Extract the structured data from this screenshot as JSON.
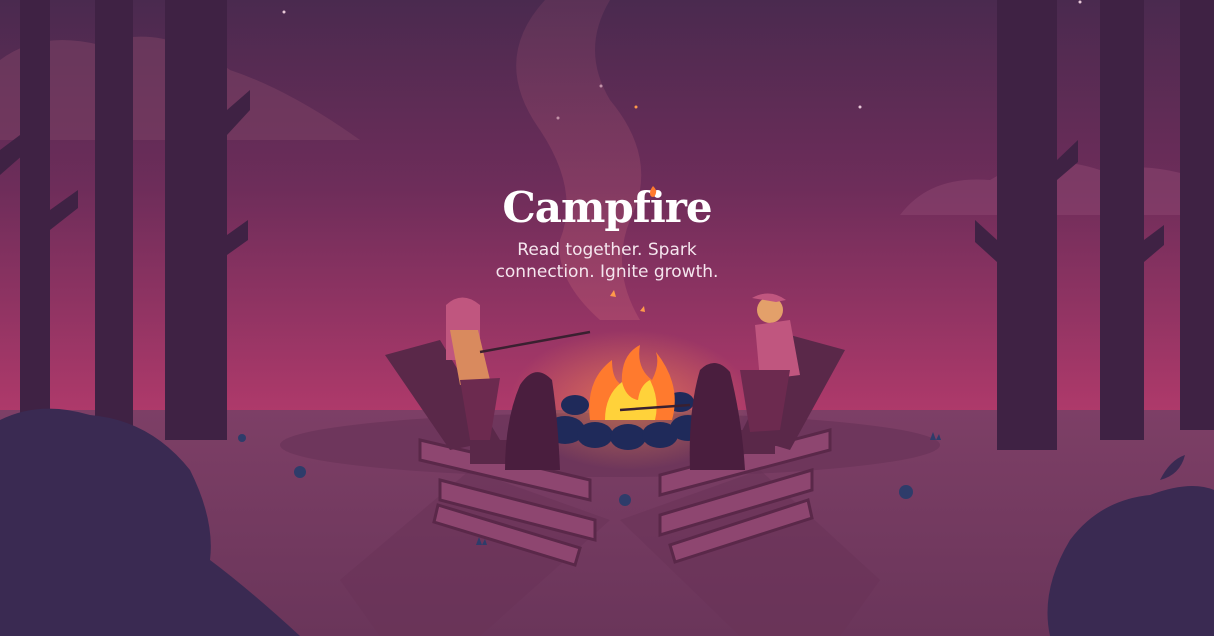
{
  "brand": {
    "name": "Campfire",
    "tagline": "Read together. Spark connection. Ignite growth."
  },
  "icons": {
    "logo_flame": "flame-icon"
  },
  "colors": {
    "sky_top": "#4a2a4f",
    "sky_bottom": "#a83a6a",
    "ground": "#7a3d62",
    "tree": "#3d2140",
    "flame_outer": "#ff7a2e",
    "flame_inner": "#ffd23a",
    "text": "#ffffff"
  }
}
